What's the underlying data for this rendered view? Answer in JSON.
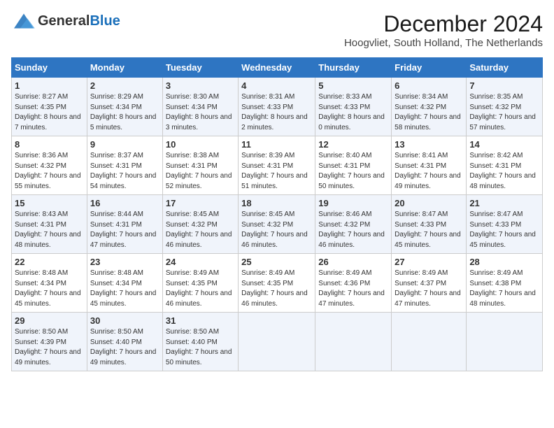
{
  "header": {
    "logo_general": "General",
    "logo_blue": "Blue",
    "title": "December 2024",
    "subtitle": "Hoogvliet, South Holland, The Netherlands"
  },
  "weekdays": [
    "Sunday",
    "Monday",
    "Tuesday",
    "Wednesday",
    "Thursday",
    "Friday",
    "Saturday"
  ],
  "weeks": [
    [
      {
        "day": "1",
        "sunrise": "Sunrise: 8:27 AM",
        "sunset": "Sunset: 4:35 PM",
        "daylight": "Daylight: 8 hours and 7 minutes."
      },
      {
        "day": "2",
        "sunrise": "Sunrise: 8:29 AM",
        "sunset": "Sunset: 4:34 PM",
        "daylight": "Daylight: 8 hours and 5 minutes."
      },
      {
        "day": "3",
        "sunrise": "Sunrise: 8:30 AM",
        "sunset": "Sunset: 4:34 PM",
        "daylight": "Daylight: 8 hours and 3 minutes."
      },
      {
        "day": "4",
        "sunrise": "Sunrise: 8:31 AM",
        "sunset": "Sunset: 4:33 PM",
        "daylight": "Daylight: 8 hours and 2 minutes."
      },
      {
        "day": "5",
        "sunrise": "Sunrise: 8:33 AM",
        "sunset": "Sunset: 4:33 PM",
        "daylight": "Daylight: 8 hours and 0 minutes."
      },
      {
        "day": "6",
        "sunrise": "Sunrise: 8:34 AM",
        "sunset": "Sunset: 4:32 PM",
        "daylight": "Daylight: 7 hours and 58 minutes."
      },
      {
        "day": "7",
        "sunrise": "Sunrise: 8:35 AM",
        "sunset": "Sunset: 4:32 PM",
        "daylight": "Daylight: 7 hours and 57 minutes."
      }
    ],
    [
      {
        "day": "8",
        "sunrise": "Sunrise: 8:36 AM",
        "sunset": "Sunset: 4:32 PM",
        "daylight": "Daylight: 7 hours and 55 minutes."
      },
      {
        "day": "9",
        "sunrise": "Sunrise: 8:37 AM",
        "sunset": "Sunset: 4:31 PM",
        "daylight": "Daylight: 7 hours and 54 minutes."
      },
      {
        "day": "10",
        "sunrise": "Sunrise: 8:38 AM",
        "sunset": "Sunset: 4:31 PM",
        "daylight": "Daylight: 7 hours and 52 minutes."
      },
      {
        "day": "11",
        "sunrise": "Sunrise: 8:39 AM",
        "sunset": "Sunset: 4:31 PM",
        "daylight": "Daylight: 7 hours and 51 minutes."
      },
      {
        "day": "12",
        "sunrise": "Sunrise: 8:40 AM",
        "sunset": "Sunset: 4:31 PM",
        "daylight": "Daylight: 7 hours and 50 minutes."
      },
      {
        "day": "13",
        "sunrise": "Sunrise: 8:41 AM",
        "sunset": "Sunset: 4:31 PM",
        "daylight": "Daylight: 7 hours and 49 minutes."
      },
      {
        "day": "14",
        "sunrise": "Sunrise: 8:42 AM",
        "sunset": "Sunset: 4:31 PM",
        "daylight": "Daylight: 7 hours and 48 minutes."
      }
    ],
    [
      {
        "day": "15",
        "sunrise": "Sunrise: 8:43 AM",
        "sunset": "Sunset: 4:31 PM",
        "daylight": "Daylight: 7 hours and 48 minutes."
      },
      {
        "day": "16",
        "sunrise": "Sunrise: 8:44 AM",
        "sunset": "Sunset: 4:31 PM",
        "daylight": "Daylight: 7 hours and 47 minutes."
      },
      {
        "day": "17",
        "sunrise": "Sunrise: 8:45 AM",
        "sunset": "Sunset: 4:32 PM",
        "daylight": "Daylight: 7 hours and 46 minutes."
      },
      {
        "day": "18",
        "sunrise": "Sunrise: 8:45 AM",
        "sunset": "Sunset: 4:32 PM",
        "daylight": "Daylight: 7 hours and 46 minutes."
      },
      {
        "day": "19",
        "sunrise": "Sunrise: 8:46 AM",
        "sunset": "Sunset: 4:32 PM",
        "daylight": "Daylight: 7 hours and 46 minutes."
      },
      {
        "day": "20",
        "sunrise": "Sunrise: 8:47 AM",
        "sunset": "Sunset: 4:33 PM",
        "daylight": "Daylight: 7 hours and 45 minutes."
      },
      {
        "day": "21",
        "sunrise": "Sunrise: 8:47 AM",
        "sunset": "Sunset: 4:33 PM",
        "daylight": "Daylight: 7 hours and 45 minutes."
      }
    ],
    [
      {
        "day": "22",
        "sunrise": "Sunrise: 8:48 AM",
        "sunset": "Sunset: 4:34 PM",
        "daylight": "Daylight: 7 hours and 45 minutes."
      },
      {
        "day": "23",
        "sunrise": "Sunrise: 8:48 AM",
        "sunset": "Sunset: 4:34 PM",
        "daylight": "Daylight: 7 hours and 45 minutes."
      },
      {
        "day": "24",
        "sunrise": "Sunrise: 8:49 AM",
        "sunset": "Sunset: 4:35 PM",
        "daylight": "Daylight: 7 hours and 46 minutes."
      },
      {
        "day": "25",
        "sunrise": "Sunrise: 8:49 AM",
        "sunset": "Sunset: 4:35 PM",
        "daylight": "Daylight: 7 hours and 46 minutes."
      },
      {
        "day": "26",
        "sunrise": "Sunrise: 8:49 AM",
        "sunset": "Sunset: 4:36 PM",
        "daylight": "Daylight: 7 hours and 47 minutes."
      },
      {
        "day": "27",
        "sunrise": "Sunrise: 8:49 AM",
        "sunset": "Sunset: 4:37 PM",
        "daylight": "Daylight: 7 hours and 47 minutes."
      },
      {
        "day": "28",
        "sunrise": "Sunrise: 8:49 AM",
        "sunset": "Sunset: 4:38 PM",
        "daylight": "Daylight: 7 hours and 48 minutes."
      }
    ],
    [
      {
        "day": "29",
        "sunrise": "Sunrise: 8:50 AM",
        "sunset": "Sunset: 4:39 PM",
        "daylight": "Daylight: 7 hours and 49 minutes."
      },
      {
        "day": "30",
        "sunrise": "Sunrise: 8:50 AM",
        "sunset": "Sunset: 4:40 PM",
        "daylight": "Daylight: 7 hours and 49 minutes."
      },
      {
        "day": "31",
        "sunrise": "Sunrise: 8:50 AM",
        "sunset": "Sunset: 4:40 PM",
        "daylight": "Daylight: 7 hours and 50 minutes."
      },
      null,
      null,
      null,
      null
    ]
  ]
}
